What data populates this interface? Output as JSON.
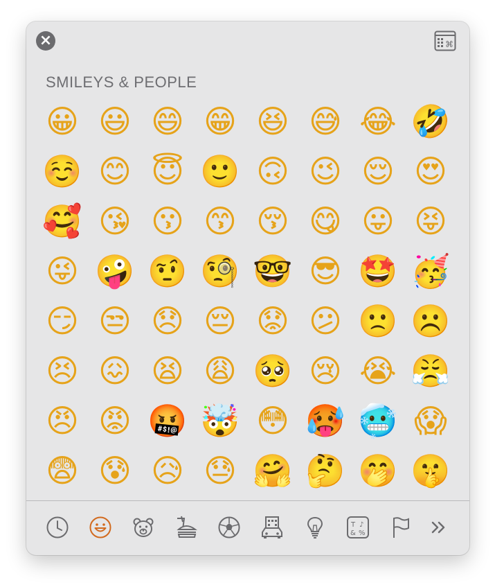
{
  "section": {
    "title": "SMILEYS & PEOPLE"
  },
  "emojis": [
    {
      "name": "grinning-face",
      "char": "😀"
    },
    {
      "name": "grinning-face-big-eyes",
      "char": "😃"
    },
    {
      "name": "grinning-face-smiling-eyes",
      "char": "😄"
    },
    {
      "name": "beaming-face",
      "char": "😁"
    },
    {
      "name": "grinning-squinting-face",
      "char": "😆"
    },
    {
      "name": "grinning-face-sweat",
      "char": "😅"
    },
    {
      "name": "face-tears-of-joy",
      "char": "😂"
    },
    {
      "name": "rolling-on-floor-laughing",
      "char": "🤣"
    },
    {
      "name": "smiling-face",
      "char": "☺️"
    },
    {
      "name": "smiling-face-smiling-eyes",
      "char": "😊"
    },
    {
      "name": "smiling-face-halo",
      "char": "😇"
    },
    {
      "name": "slightly-smiling-face",
      "char": "🙂"
    },
    {
      "name": "upside-down-face",
      "char": "🙃"
    },
    {
      "name": "winking-face",
      "char": "😉"
    },
    {
      "name": "relieved-face",
      "char": "😌"
    },
    {
      "name": "heart-eyes",
      "char": "😍"
    },
    {
      "name": "smiling-face-hearts",
      "char": "🥰"
    },
    {
      "name": "face-blowing-kiss",
      "char": "😘"
    },
    {
      "name": "kissing-face",
      "char": "😗"
    },
    {
      "name": "kissing-face-smiling-eyes",
      "char": "😙"
    },
    {
      "name": "kissing-face-closed-eyes",
      "char": "😚"
    },
    {
      "name": "face-savoring-food",
      "char": "😋"
    },
    {
      "name": "face-tongue",
      "char": "😛"
    },
    {
      "name": "squinting-face-tongue",
      "char": "😝"
    },
    {
      "name": "winking-face-tongue",
      "char": "😜"
    },
    {
      "name": "zany-face",
      "char": "🤪"
    },
    {
      "name": "face-raised-eyebrow",
      "char": "🤨"
    },
    {
      "name": "face-monocle",
      "char": "🧐"
    },
    {
      "name": "nerd-face",
      "char": "🤓"
    },
    {
      "name": "smiling-face-sunglasses",
      "char": "😎"
    },
    {
      "name": "star-struck",
      "char": "🤩"
    },
    {
      "name": "partying-face",
      "char": "🥳"
    },
    {
      "name": "smirking-face",
      "char": "😏"
    },
    {
      "name": "unamused-face",
      "char": "😒"
    },
    {
      "name": "disappointed-face",
      "char": "😞"
    },
    {
      "name": "pensive-face",
      "char": "😔"
    },
    {
      "name": "worried-face",
      "char": "😟"
    },
    {
      "name": "confused-face",
      "char": "😕"
    },
    {
      "name": "slightly-frowning-face",
      "char": "🙁"
    },
    {
      "name": "frowning-face",
      "char": "☹️"
    },
    {
      "name": "persevering-face",
      "char": "😣"
    },
    {
      "name": "confounded-face",
      "char": "😖"
    },
    {
      "name": "tired-face",
      "char": "😫"
    },
    {
      "name": "weary-face",
      "char": "😩"
    },
    {
      "name": "pleading-face",
      "char": "🥺"
    },
    {
      "name": "crying-face",
      "char": "😢"
    },
    {
      "name": "loudly-crying-face",
      "char": "😭"
    },
    {
      "name": "face-steam-nose",
      "char": "😤"
    },
    {
      "name": "angry-face",
      "char": "😠"
    },
    {
      "name": "pouting-face",
      "char": "😡"
    },
    {
      "name": "face-symbols-mouth",
      "char": "🤬"
    },
    {
      "name": "exploding-head",
      "char": "🤯"
    },
    {
      "name": "flushed-face",
      "char": "😳"
    },
    {
      "name": "hot-face",
      "char": "🥵"
    },
    {
      "name": "cold-face",
      "char": "🥶"
    },
    {
      "name": "face-screaming-fear",
      "char": "😱"
    },
    {
      "name": "fearful-face",
      "char": "😨"
    },
    {
      "name": "anxious-face-sweat",
      "char": "😰"
    },
    {
      "name": "sad-relieved-face",
      "char": "😥"
    },
    {
      "name": "downcast-face-sweat",
      "char": "😓"
    },
    {
      "name": "hugging-face",
      "char": "🤗"
    },
    {
      "name": "thinking-face",
      "char": "🤔"
    },
    {
      "name": "face-hand-over-mouth",
      "char": "🤭"
    },
    {
      "name": "shushing-face",
      "char": "🤫"
    }
  ],
  "tabs": [
    {
      "name": "frequently-used",
      "icon": "clock-icon"
    },
    {
      "name": "smileys-people",
      "icon": "smiley-icon",
      "selected": true
    },
    {
      "name": "animals-nature",
      "icon": "bear-icon"
    },
    {
      "name": "food-drink",
      "icon": "food-icon"
    },
    {
      "name": "activity",
      "icon": "soccer-ball-icon"
    },
    {
      "name": "travel-places",
      "icon": "building-car-icon"
    },
    {
      "name": "objects",
      "icon": "lightbulb-icon"
    },
    {
      "name": "symbols",
      "icon": "symbols-icon"
    },
    {
      "name": "flags",
      "icon": "flag-icon"
    },
    {
      "name": "more",
      "icon": "double-chevron-icon"
    }
  ],
  "colors": {
    "accent": "#d26a1e",
    "icon": "#6b6b6e",
    "panel": "#e6e6e7"
  }
}
